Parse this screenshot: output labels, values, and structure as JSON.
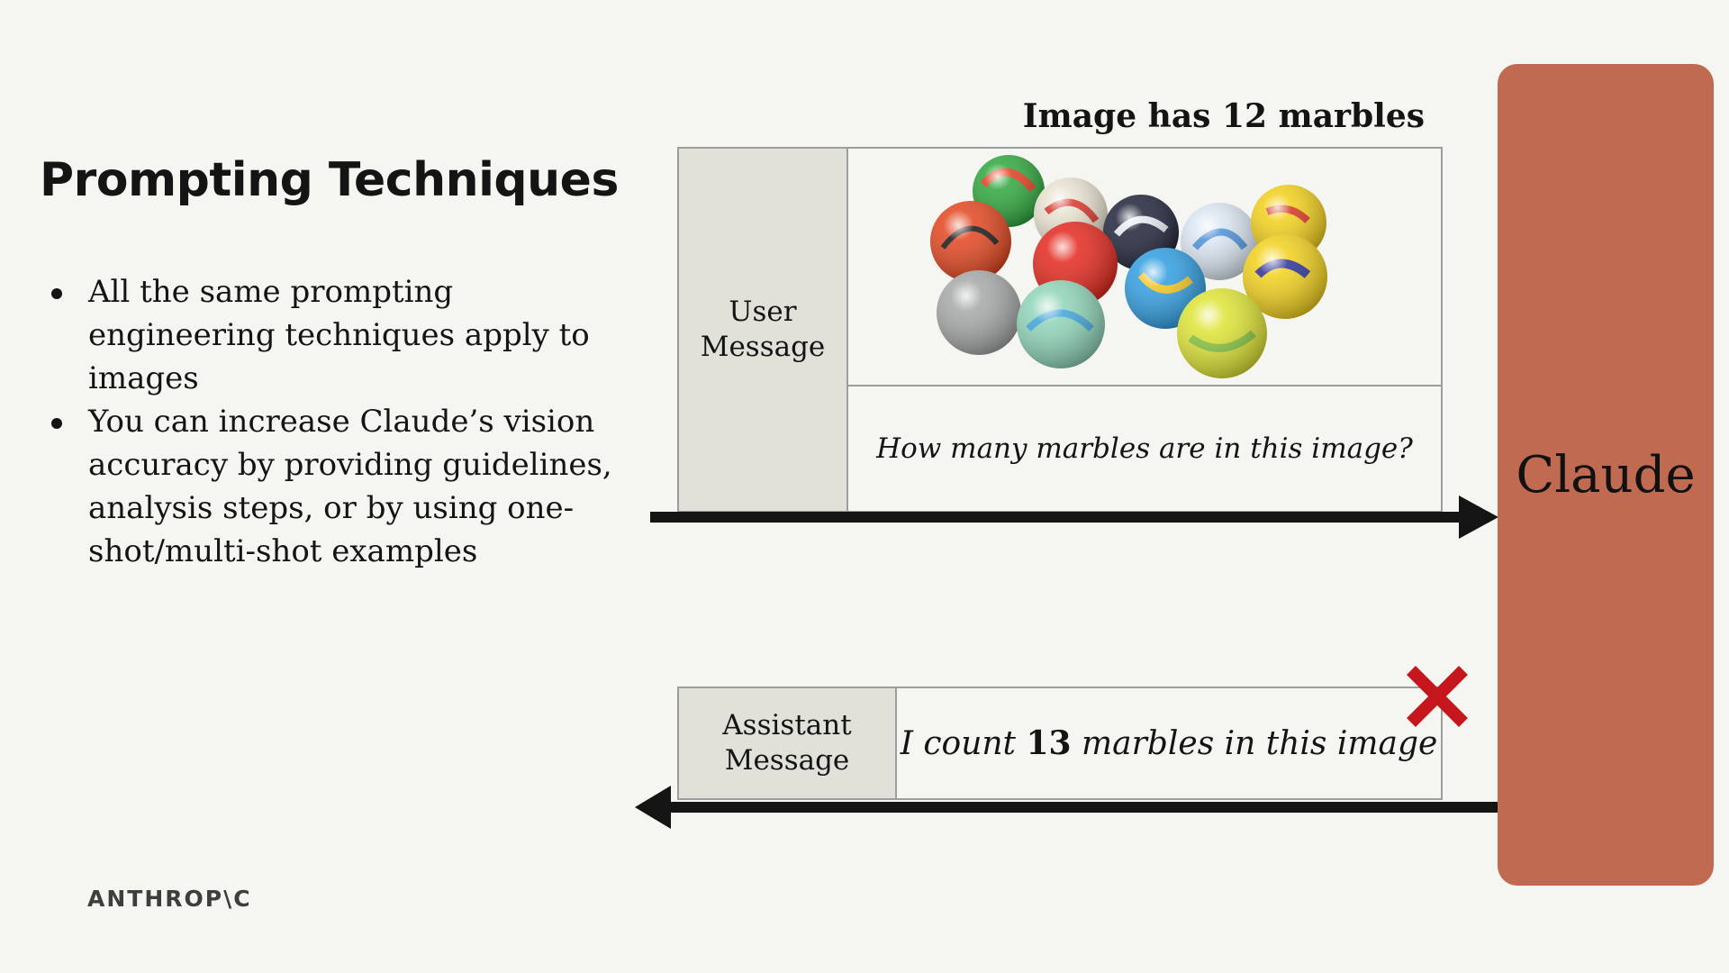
{
  "slide": {
    "title": "Prompting Techniques",
    "bullets": [
      "All the same prompting engineering techniques apply to images",
      "You can increase Claude’s vision accuracy by providing guidelines, analysis steps, or by using one-shot/multi-shot examples"
    ],
    "brand": "ANTHROP\\C"
  },
  "diagram": {
    "caption": "Image has 12 marbles",
    "user_message": {
      "label_line1": "User",
      "label_line2": "Message",
      "image": "marbles-photo",
      "question": "How many marbles are in this image?"
    },
    "assistant_message": {
      "label_line1": "Assistant",
      "label_line2": "Message",
      "answer_prefix": "I count ",
      "answer_count": "13",
      "answer_suffix": " marbles in this image",
      "status_icon": "red-x-icon"
    },
    "model_label": "Claude"
  },
  "colors": {
    "background": "#f5f6f1",
    "claude_block": "#c06b51",
    "label_cell": "#e1e1da",
    "x_mark": "#c4161c",
    "arrow": "#141414"
  }
}
